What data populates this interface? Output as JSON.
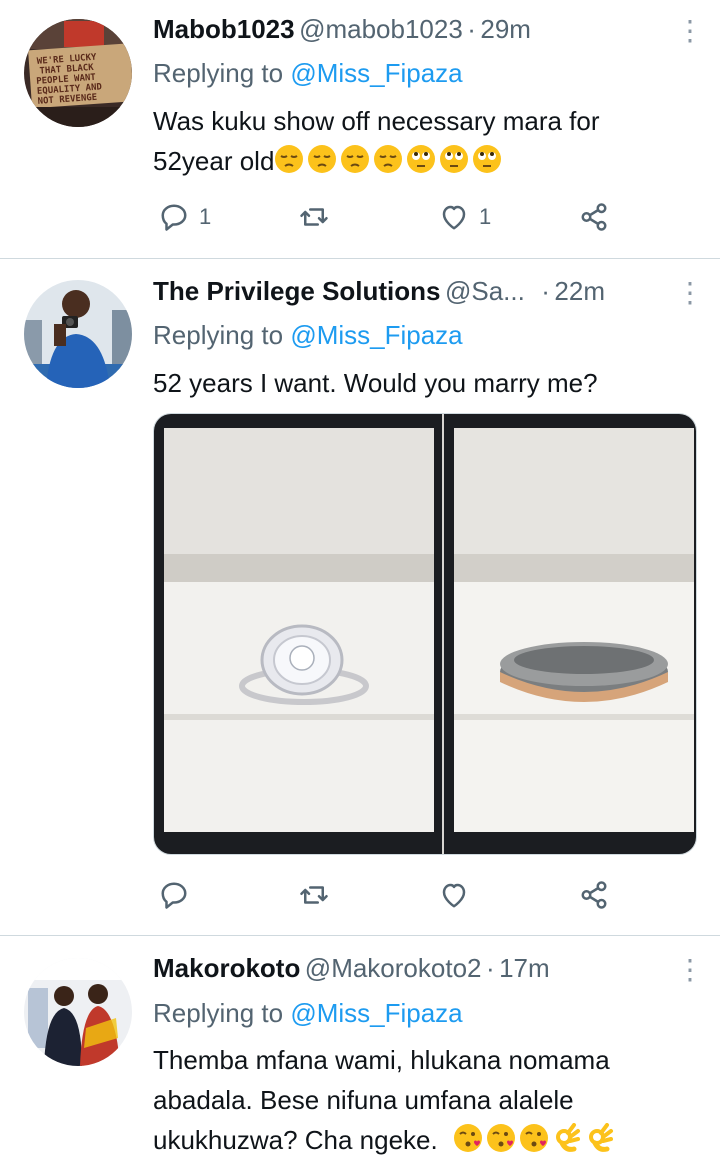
{
  "tweets": [
    {
      "name": "Mabob1023",
      "handle": "@mabob1023",
      "separator": "·",
      "time": "29m",
      "replying_prefix": "Replying to",
      "replying_to": "@Miss_Fipaza",
      "text_line1": "Was kuku show off necessary mara for",
      "text_line2": "52year old",
      "emojis": [
        "pensive-face",
        "pensive-face",
        "pensive-face",
        "pensive-face",
        "rolling-eyes-face",
        "rolling-eyes-face",
        "rolling-eyes-face"
      ],
      "avatar_sign_text": "WE'RE LUCKY THAT BLACK PEOPLE WANT EQUALITY AND NOT REVENGE",
      "reply_count": "1",
      "retweet_count": "",
      "like_count": "1"
    },
    {
      "name": "The Privilege Solutions",
      "handle": "@Sa...",
      "separator": "·",
      "time": "22m",
      "replying_prefix": "Replying to",
      "replying_to": "@Miss_Fipaza",
      "text_line1": "52 years I want. Would you marry me?",
      "reply_count": "",
      "retweet_count": "",
      "like_count": ""
    },
    {
      "name": "Makorokoto",
      "handle": "@Makorokoto2",
      "separator": "·",
      "time": "17m",
      "replying_prefix": "Replying to",
      "replying_to": "@Miss_Fipaza",
      "text_line1": "Themba mfana wami, hlukana nomama",
      "text_line2": "abadala. Bese nifuna umfana alalele",
      "text_line3": "ukukhuzwa? Cha ngeke.",
      "emojis": [
        "kissing-heart-face",
        "kissing-heart-face",
        "kissing-heart-face",
        "ok-hand",
        "ok-hand"
      ]
    }
  ],
  "colors": {
    "link": "#1d9bf0",
    "secondary_text": "#536471",
    "divider": "#cfd9de"
  }
}
